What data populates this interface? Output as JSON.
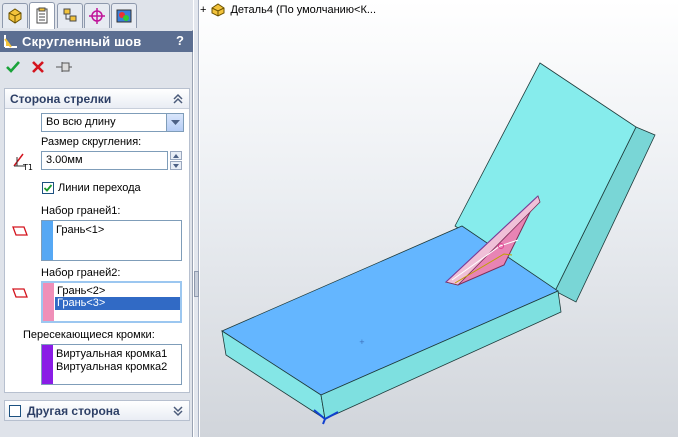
{
  "tabs": [
    {
      "name": "feature-manager"
    },
    {
      "name": "property-manager"
    },
    {
      "name": "configuration-manager"
    },
    {
      "name": "dimxpert-manager"
    },
    {
      "name": "display-manager"
    }
  ],
  "panel": {
    "title": "Скругленный шов",
    "help": "?"
  },
  "group_arrow_side": {
    "title": "Сторона стрелки",
    "length_option": "Во всю длину",
    "size_label": "Размер скругления:",
    "size_value": "3.00мм",
    "tangent_label": "Линии перехода",
    "face_set1_label": "Набор граней1:",
    "face_set1_items": [
      "Грань<1>"
    ],
    "face_set2_label": "Набор граней2:",
    "face_set2_items": [
      "Грань<2>",
      "Грань<3>"
    ],
    "intersect_label": "Пересекающиеся кромки:",
    "intersect_items": [
      "Виртуальная кромка1",
      "Виртуальная кромка2"
    ]
  },
  "group_other_side": {
    "title": "Другая сторона"
  },
  "viewport": {
    "tree_expand": "+",
    "tree_label": "Деталь4  (По умолчанию<К..."
  },
  "colors": {
    "title_bar": "#5b6e91",
    "face_set1": "#56a8f4",
    "face_set2": "#ef8fb8",
    "intersect": "#8a1ce6",
    "part_top": "#7cc6f0",
    "part_side": "#8ee8e6"
  }
}
